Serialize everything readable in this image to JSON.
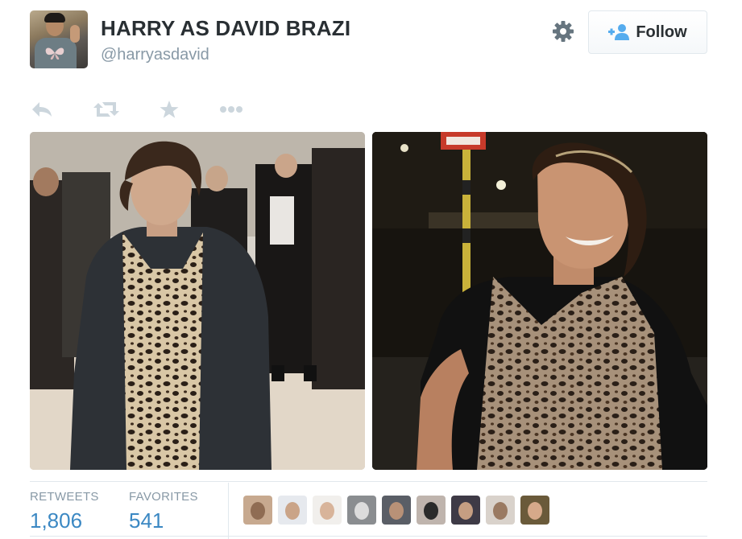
{
  "tweet": {
    "display_name": "HARRY AS DAVID BRAZI",
    "handle": "@harryasdavid",
    "follow_label": "Follow"
  },
  "icons": {
    "reply": "reply-icon",
    "retweet": "retweet-icon",
    "favorite": "star-icon",
    "more": "more-icon",
    "settings": "gear-icon",
    "follow": "add-user-icon"
  },
  "stats": {
    "retweets_label": "RETWEETS",
    "retweets_value": "1,806",
    "favorites_label": "FAVORITES",
    "favorites_value": "541"
  },
  "favoriters": [
    {
      "name": "favoriter-1",
      "bg": "#c7a98f",
      "face": "#8f6c53"
    },
    {
      "name": "favoriter-2",
      "bg": "#e6e9ee",
      "face": "#caa488"
    },
    {
      "name": "favoriter-3",
      "bg": "#f1efec",
      "face": "#d8b49a"
    },
    {
      "name": "favoriter-4",
      "bg": "#8a8d90",
      "face": "#dcdcdc"
    },
    {
      "name": "favoriter-5",
      "bg": "#5a5e66",
      "face": "#b89177"
    },
    {
      "name": "favoriter-6",
      "bg": "#bfb4ad",
      "face": "#2a2a2a"
    },
    {
      "name": "favoriter-7",
      "bg": "#3e3a46",
      "face": "#c59e82"
    },
    {
      "name": "favoriter-8",
      "bg": "#d9d2cb",
      "face": "#9a7a62"
    },
    {
      "name": "favoriter-9",
      "bg": "#6a5a3a",
      "face": "#d6a98a"
    }
  ],
  "colors": {
    "name_text": "#292f33",
    "muted": "#8899a6",
    "stat_blue": "#3b88c3",
    "icon_gray": "#ccd6dd",
    "follow_icon_blue": "#55acee",
    "border": "#e1e8ed"
  }
}
